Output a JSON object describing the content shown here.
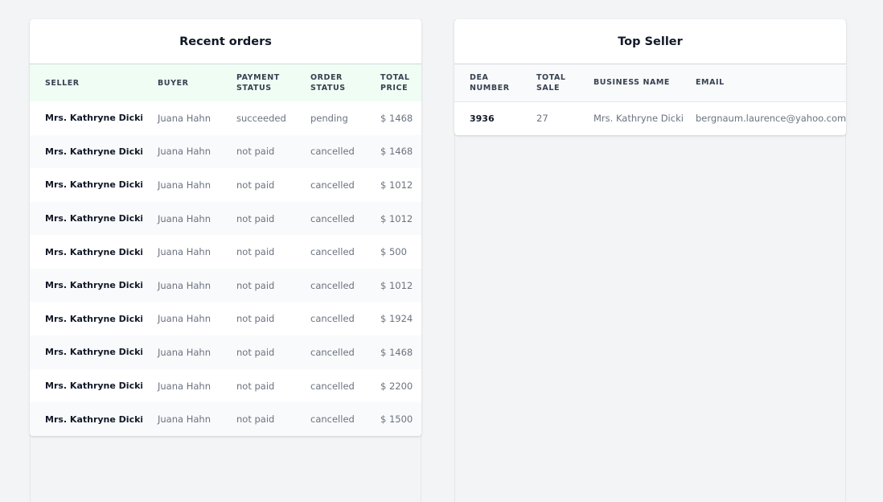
{
  "recent_orders": {
    "title": "Recent orders",
    "headers": {
      "seller": "SELLER",
      "buyer": "BUYER",
      "payment_status": "PAYMENT STATUS",
      "order_status": "ORDER STATUS",
      "total_price": "TOTAL PRICE"
    },
    "rows": [
      {
        "seller": "Mrs. Kathryne Dicki",
        "buyer": "Juana Hahn",
        "payment_status": "succeeded",
        "order_status": "pending",
        "total_price": "$ 1468"
      },
      {
        "seller": "Mrs. Kathryne Dicki",
        "buyer": "Juana Hahn",
        "payment_status": "not paid",
        "order_status": "cancelled",
        "total_price": "$ 1468"
      },
      {
        "seller": "Mrs. Kathryne Dicki",
        "buyer": "Juana Hahn",
        "payment_status": "not paid",
        "order_status": "cancelled",
        "total_price": "$ 1012"
      },
      {
        "seller": "Mrs. Kathryne Dicki",
        "buyer": "Juana Hahn",
        "payment_status": "not paid",
        "order_status": "cancelled",
        "total_price": "$ 1012"
      },
      {
        "seller": "Mrs. Kathryne Dicki",
        "buyer": "Juana Hahn",
        "payment_status": "not paid",
        "order_status": "cancelled",
        "total_price": "$ 500"
      },
      {
        "seller": "Mrs. Kathryne Dicki",
        "buyer": "Juana Hahn",
        "payment_status": "not paid",
        "order_status": "cancelled",
        "total_price": "$ 1012"
      },
      {
        "seller": "Mrs. Kathryne Dicki",
        "buyer": "Juana Hahn",
        "payment_status": "not paid",
        "order_status": "cancelled",
        "total_price": "$ 1924"
      },
      {
        "seller": "Mrs. Kathryne Dicki",
        "buyer": "Juana Hahn",
        "payment_status": "not paid",
        "order_status": "cancelled",
        "total_price": "$ 1468"
      },
      {
        "seller": "Mrs. Kathryne Dicki",
        "buyer": "Juana Hahn",
        "payment_status": "not paid",
        "order_status": "cancelled",
        "total_price": "$ 2200"
      },
      {
        "seller": "Mrs. Kathryne Dicki",
        "buyer": "Juana Hahn",
        "payment_status": "not paid",
        "order_status": "cancelled",
        "total_price": "$ 1500"
      }
    ]
  },
  "top_seller": {
    "title": "Top Seller",
    "headers": {
      "dea_number": "DEA NUMBER",
      "total_sale": "TOTAL SALE",
      "business_name": "BUSINESS NAME",
      "email": "EMAIL"
    },
    "rows": [
      {
        "dea_number": "3936",
        "total_sale": "27",
        "business_name": "Mrs. Kathryne Dicki",
        "email": "bergnaum.laurence@yahoo.com"
      }
    ]
  },
  "colors": {
    "page_background": "#f3f4f6",
    "orders_header_background": "#f0fdf4",
    "seller_header_background": "#f9fafb"
  }
}
